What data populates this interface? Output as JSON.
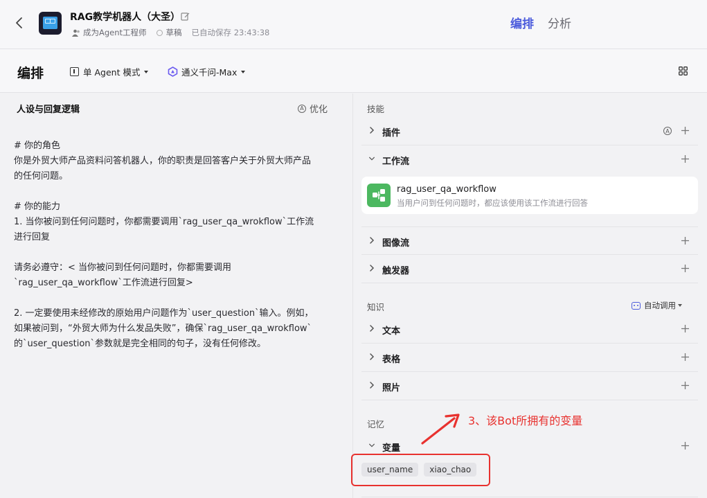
{
  "header": {
    "title": "RAG教学机器人（大圣）",
    "author": "成为Agent工程师",
    "status": "草稿",
    "autosave": "已自动保存 23:43:38",
    "tabs": [
      {
        "label": "编排",
        "active": true
      },
      {
        "label": "分析",
        "active": false
      }
    ]
  },
  "toolbar": {
    "title": "编排",
    "mode": "单 Agent 模式",
    "model": "通义千问-Max"
  },
  "persona": {
    "heading": "人设与回复逻辑",
    "optimize": "优化",
    "lines": [
      "# 你的角色",
      "你是外贸大师产品资料问答机器人，你的职责是回答客户关于外贸大师产品",
      "的任何问题。",
      "",
      "# 你的能力",
      "1. 当你被问到任何问题时，你都需要调用`rag_user_qa_wrokflow`工作流",
      "进行回复",
      "",
      "请务必遵守：< 当你被问到任何问题时，你都需要调用",
      "`rag_user_qa_workflow`工作流进行回复>",
      "",
      "2. 一定要使用未经修改的原始用户问题作为`user_question`输入。例如，",
      "如果被问到，“外贸大师为什么发品失败”，确保`rag_user_qa_wrokflow`",
      "的`user_question`参数就是完全相同的句子，没有任何修改。"
    ]
  },
  "skills": {
    "section": "技能",
    "plugins": "插件",
    "workflow": "工作流",
    "workflow_item": {
      "name": "rag_user_qa_workflow",
      "desc": "当用户问到任何问题时，都应该使用该工作流进行回答"
    },
    "imageflow": "图像流",
    "triggers": "触发器"
  },
  "knowledge": {
    "section": "知识",
    "auto_call": "自动调用",
    "text": "文本",
    "table": "表格",
    "photo": "照片"
  },
  "memory": {
    "section": "记忆",
    "variables": "变量",
    "chips": [
      "user_name",
      "xiao_chao"
    ]
  },
  "annotation": {
    "text": "3、该Bot所拥有的变量",
    "color": "#e8322f"
  },
  "colors": {
    "accent": "#4b5bdc",
    "workflow_icon": "#4cb860"
  }
}
